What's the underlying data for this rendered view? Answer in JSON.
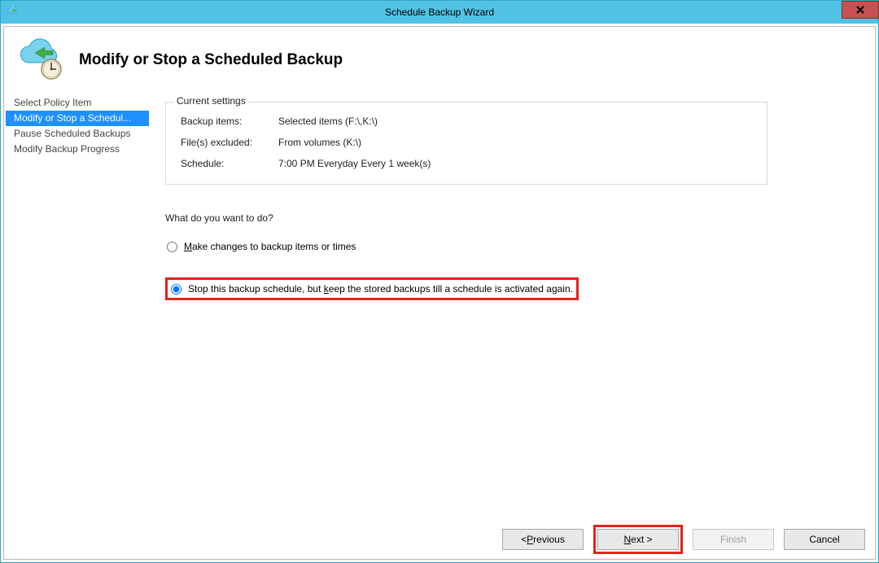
{
  "window": {
    "title": "Schedule Backup Wizard"
  },
  "header": {
    "title": "Modify or Stop a Scheduled Backup"
  },
  "sidebar": {
    "items": [
      {
        "label": "Select Policy Item"
      },
      {
        "label": "Modify or Stop a Schedul..."
      },
      {
        "label": "Pause Scheduled Backups"
      },
      {
        "label": "Modify Backup Progress"
      }
    ],
    "activeIndex": 1
  },
  "currentSettings": {
    "legend": "Current settings",
    "rows": [
      {
        "label": "Backup items:",
        "value": "Selected items (F:\\,K:\\)"
      },
      {
        "label": "File(s) excluded:",
        "value": "From volumes (K:\\)"
      },
      {
        "label": "Schedule:",
        "value": "7:00 PM Everyday Every 1 week(s)"
      }
    ]
  },
  "question": {
    "prompt": "What do you want to do?",
    "options": [
      {
        "prefix": "",
        "accel": "M",
        "rest": "ake changes to backup items or times",
        "selected": false
      },
      {
        "prefix": "Stop this backup schedule, but ",
        "accel": "k",
        "rest": "eep the stored backups till a schedule is activated again.",
        "selected": true
      }
    ]
  },
  "footer": {
    "previous": {
      "lead": "< ",
      "accel": "P",
      "rest": "revious"
    },
    "next": {
      "accel": "N",
      "rest": "ext >"
    },
    "finish": {
      "label": "Finish"
    },
    "cancel": {
      "label": "Cancel"
    }
  }
}
